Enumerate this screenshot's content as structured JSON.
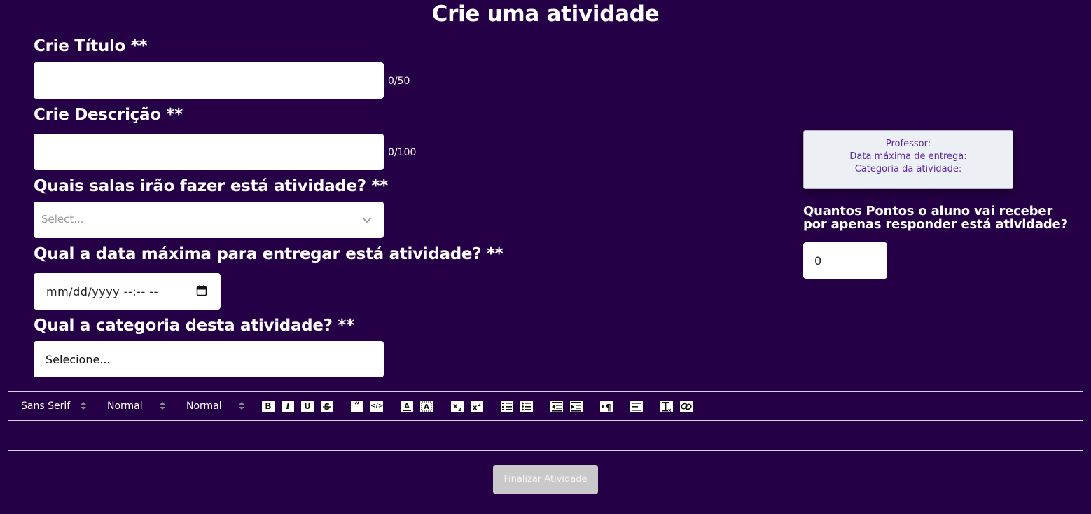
{
  "page": {
    "title": "Crie uma atividade"
  },
  "form": {
    "title_label": "Crie Título **",
    "title_value": "",
    "title_counter": "0/50",
    "description_label": "Crie Descrição **",
    "description_value": "",
    "description_counter": "0/100",
    "rooms_label": "Quais salas irão fazer está atividade? **",
    "rooms_placeholder": "Select...",
    "deadline_label": "Qual a data máxima para entregar está atividade? **",
    "deadline_placeholder": "mm/dd/yyyy --:-- --",
    "category_label": "Qual a categoria desta atividade? **",
    "category_value": "Selecione..."
  },
  "info_card": {
    "professor": "Professor:",
    "deadline": "Data máxima de entrega:",
    "category": "Categoria da atividade:"
  },
  "points": {
    "label_line1": "Quantos Pontos o aluno vai receber",
    "label_line2": "por apenas responder está atividade?",
    "value": "0"
  },
  "editor": {
    "font_picker": "Sans Serif",
    "size_picker": "Normal",
    "header_picker": "Normal",
    "buttons": [
      "bold",
      "italic",
      "underline",
      "strike",
      "blockquote",
      "code-block",
      "color",
      "background",
      "subscript",
      "superscript",
      "ordered-list",
      "bullet-list",
      "outdent",
      "indent",
      "text-direction",
      "align",
      "clean",
      "link"
    ],
    "content": ""
  },
  "actions": {
    "finish_label": "Finalizar Atividade"
  },
  "colors": {
    "background": "#260046",
    "card_text": "#5b2aa0",
    "button_disabled": "#c9c9c9"
  }
}
